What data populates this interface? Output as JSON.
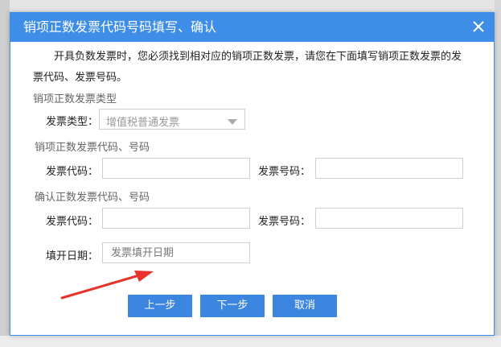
{
  "dialog": {
    "title": "销项正数发票代码号码填写、确认",
    "close_icon": "close-icon",
    "intro_text": "开具负数发票时，您必须找到相对应的销项正数发票，请您在下面填写销项正数发票的发票代码、发票号码。",
    "type_section": {
      "title": "销项正数发票类型",
      "label": "发票类型：",
      "selected_value": "增值税普通发票",
      "arrow_icon": "chevron-down-icon"
    },
    "original_section": {
      "title": "销项正数发票代码、号码",
      "code_label": "发票代码：",
      "code_value": "",
      "number_label": "发票号码：",
      "number_value": ""
    },
    "confirm_section": {
      "title": "确认正数发票代码、号码",
      "code_label": "发票代码：",
      "code_value": "",
      "number_label": "发票号码：",
      "number_value": ""
    },
    "date_field": {
      "label": "填开日期：",
      "placeholder": "发票填开日期",
      "value": ""
    },
    "buttons": {
      "prev": "上一步",
      "next": "下一步",
      "cancel": "取消"
    }
  },
  "colors": {
    "title_bar": "#3e8ee8",
    "button": "#3c86e0",
    "annotation_arrow": "#e8332a"
  }
}
